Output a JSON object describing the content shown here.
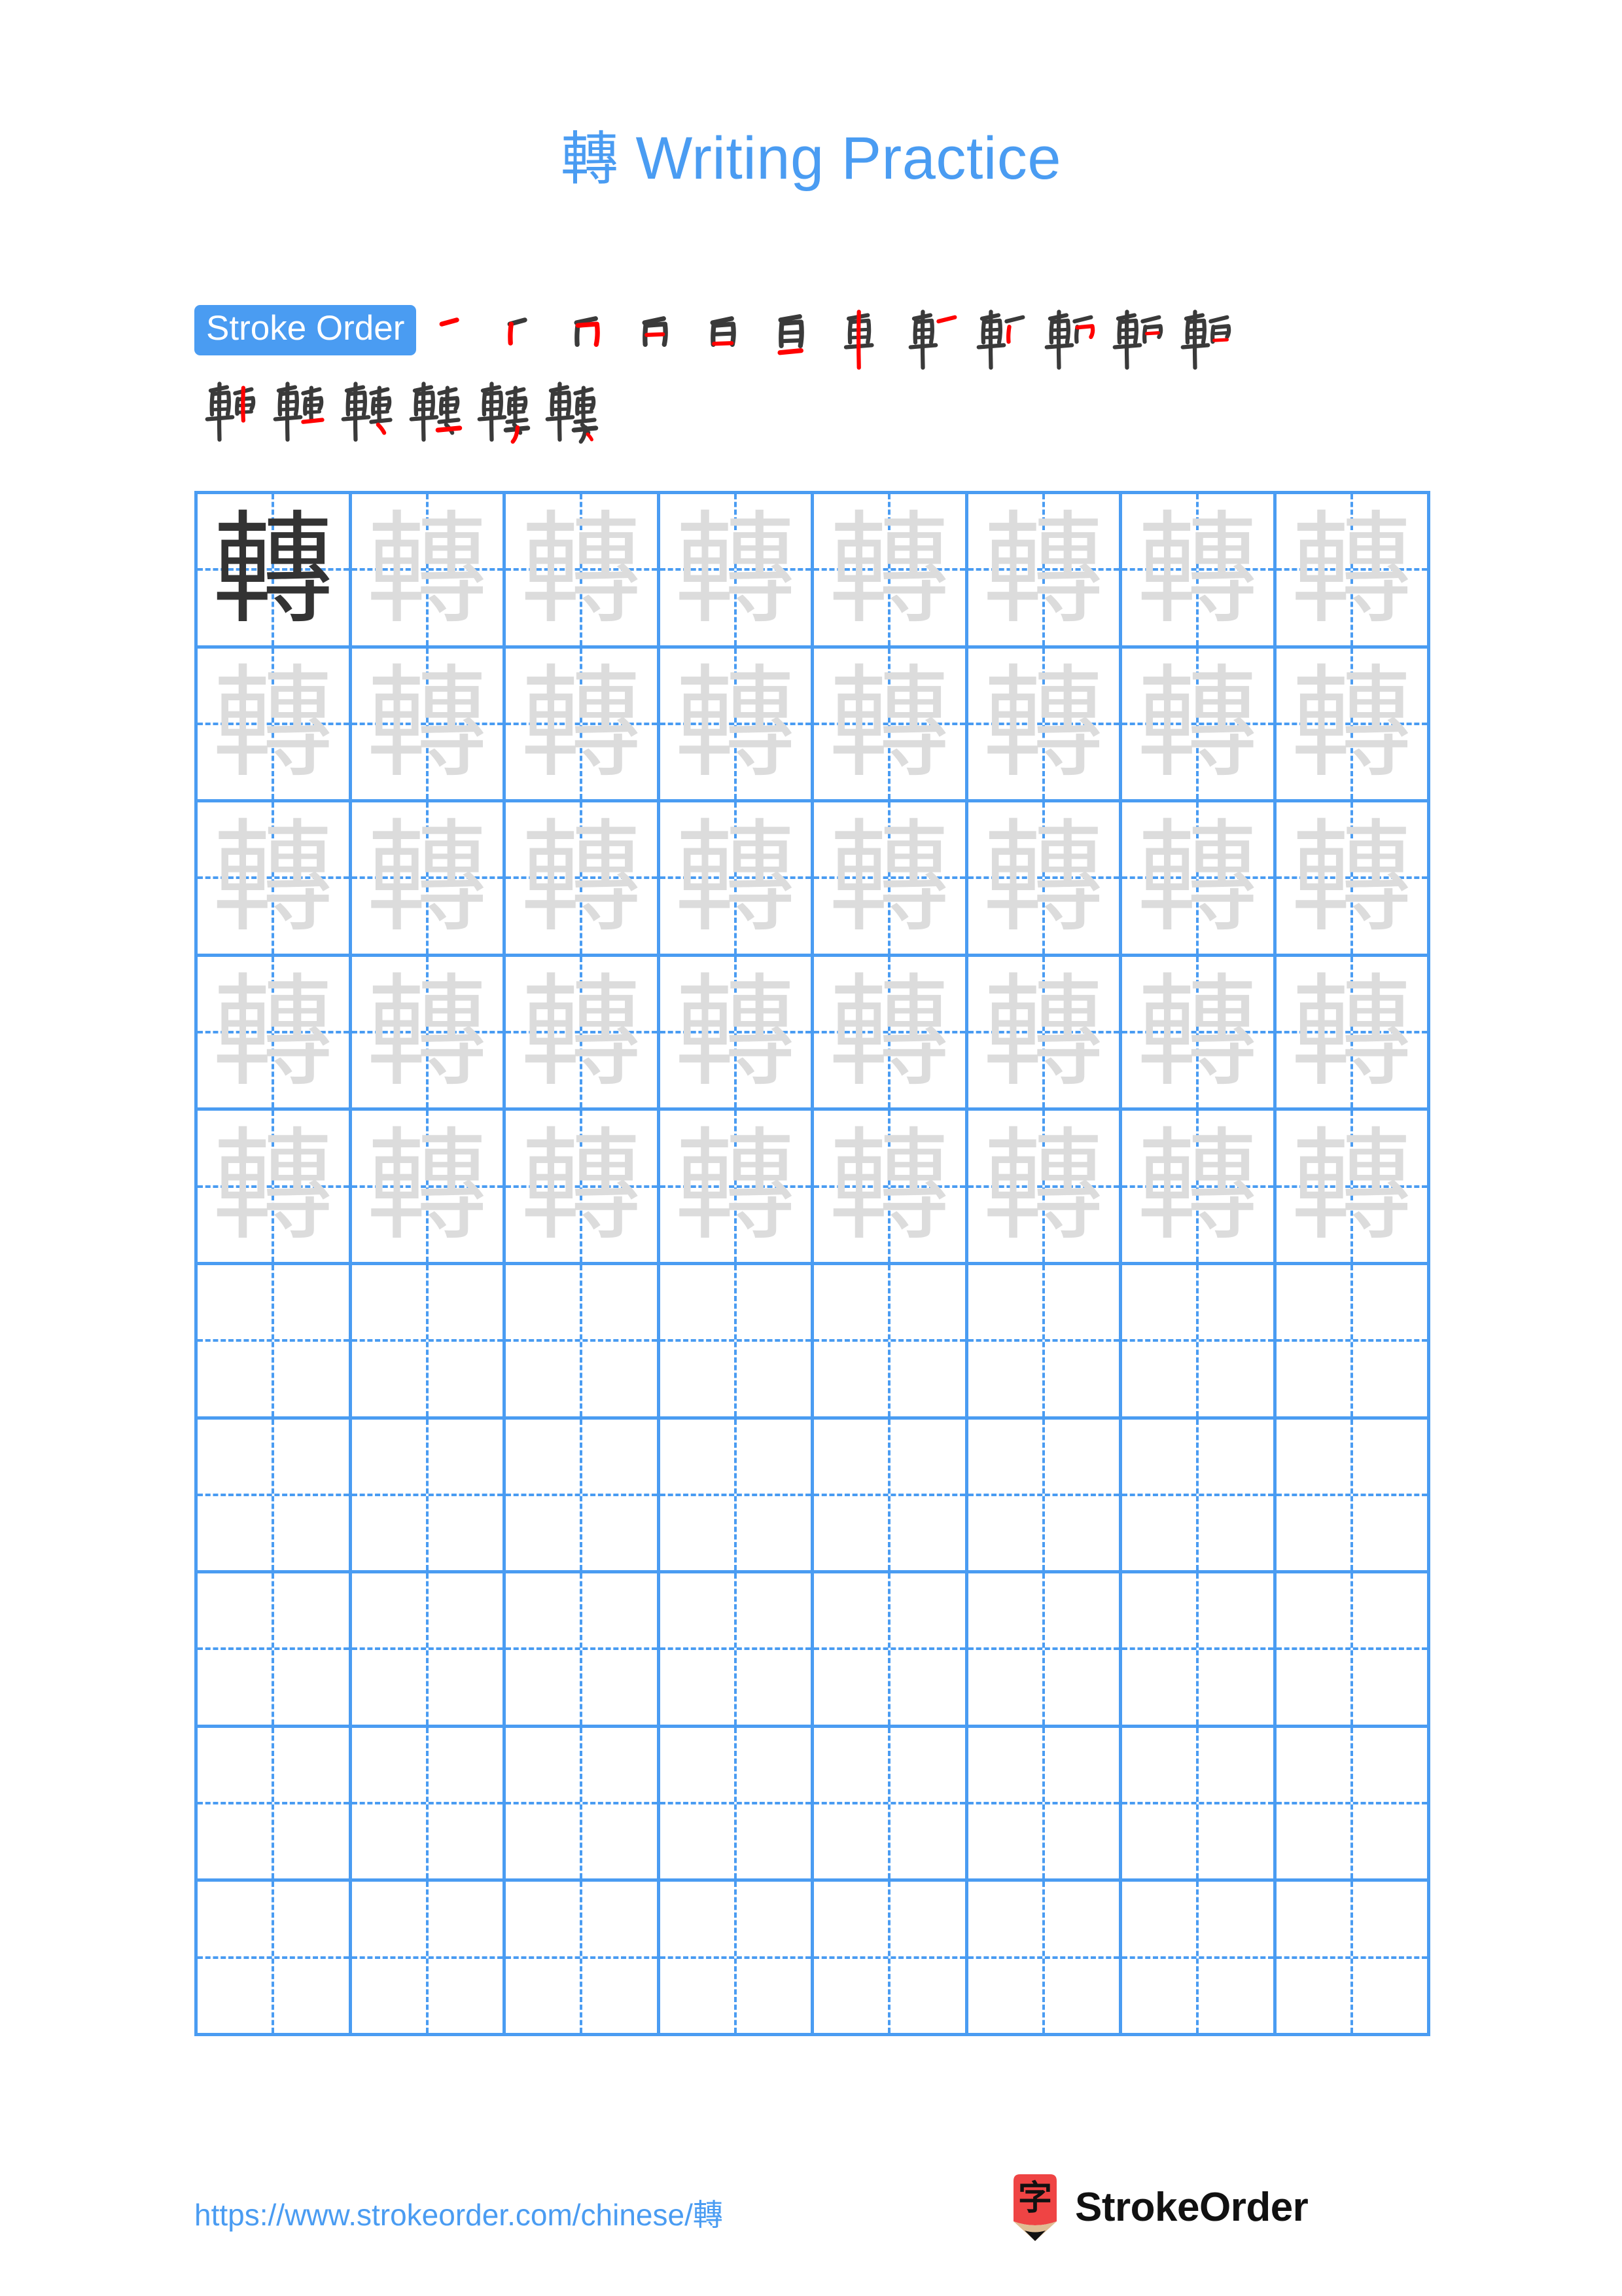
{
  "page": {
    "title_character": "轉",
    "title_text": "Writing Practice",
    "background_color": "#ffffff"
  },
  "colors": {
    "accent_blue": "#4a9cf2",
    "grid_blue": "#4a9cf2",
    "trace_gray": "#dcdcdc",
    "model_dark": "#333333",
    "stroke_black": "#3a3a3a",
    "stroke_red": "#ff0000",
    "logo_red": "#ef4444",
    "logo_wood": "#e0bd93",
    "logo_tip": "#111111"
  },
  "stroke_order": {
    "badge_label": "Stroke Order",
    "character": "轉",
    "total_strokes": 18,
    "row1_count": 12,
    "row2_count": 6,
    "steps": [
      {
        "index": 1,
        "partial": "一"
      },
      {
        "index": 2,
        "partial": "丿"
      },
      {
        "index": 3,
        "partial": "冂"
      },
      {
        "index": 4,
        "partial": "日"
      },
      {
        "index": 5,
        "partial": "白"
      },
      {
        "index": 6,
        "partial": "自"
      },
      {
        "index": 7,
        "partial": "車"
      },
      {
        "index": 8,
        "partial": "車"
      },
      {
        "index": 9,
        "partial": "軒"
      },
      {
        "index": 10,
        "partial": "軒"
      },
      {
        "index": 11,
        "partial": "転"
      },
      {
        "index": 12,
        "partial": "転"
      },
      {
        "index": 13,
        "partial": "軸"
      },
      {
        "index": 14,
        "partial": "輁"
      },
      {
        "index": 15,
        "partial": "輁"
      },
      {
        "index": 16,
        "partial": "輔"
      },
      {
        "index": 17,
        "partial": "轉"
      },
      {
        "index": 18,
        "partial": "轉"
      }
    ]
  },
  "practice_grid": {
    "columns": 8,
    "rows": 10,
    "traced_rows": 5,
    "blank_rows": 5,
    "character": "轉",
    "model_cell": {
      "row": 1,
      "column": 1
    }
  },
  "footer": {
    "url": "https://www.strokeorder.com/chinese/轉",
    "url_prefix": "https://www.strokeorder.com/chinese/",
    "url_character": "轉",
    "brand_name": "StrokeOrder",
    "logo_glyph": "字"
  }
}
